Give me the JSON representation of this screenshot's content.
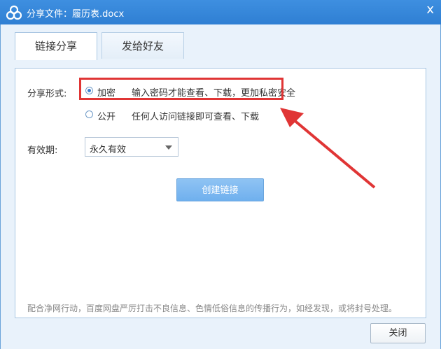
{
  "window": {
    "title": "分享文件：履历表.docx",
    "close_glyph": "x"
  },
  "tabs": [
    {
      "label": "链接分享",
      "active": true
    },
    {
      "label": "发给好友",
      "active": false
    }
  ],
  "share_form": {
    "label": "分享形式:",
    "options": [
      {
        "label": "加密",
        "description": "输入密码才能查看、下载，更加私密安全",
        "checked": true
      },
      {
        "label": "公开",
        "description": "任何人访问链接即可查看、下载",
        "checked": false
      }
    ]
  },
  "validity": {
    "label": "有效期:",
    "selected": "永久有效"
  },
  "buttons": {
    "create_link": "创建链接",
    "close": "关闭"
  },
  "footer_note": "配合净网行动，百度网盘严厉打击不良信息、色情低俗信息的传播行为，如经发现，或将封号处理。",
  "colors": {
    "accent": "#2f7fd3",
    "highlight": "#e03535"
  },
  "icons": {
    "app": "baidu-netdisk-cloud-icon",
    "close": "close-icon",
    "dropdown": "chevron-down-icon"
  }
}
